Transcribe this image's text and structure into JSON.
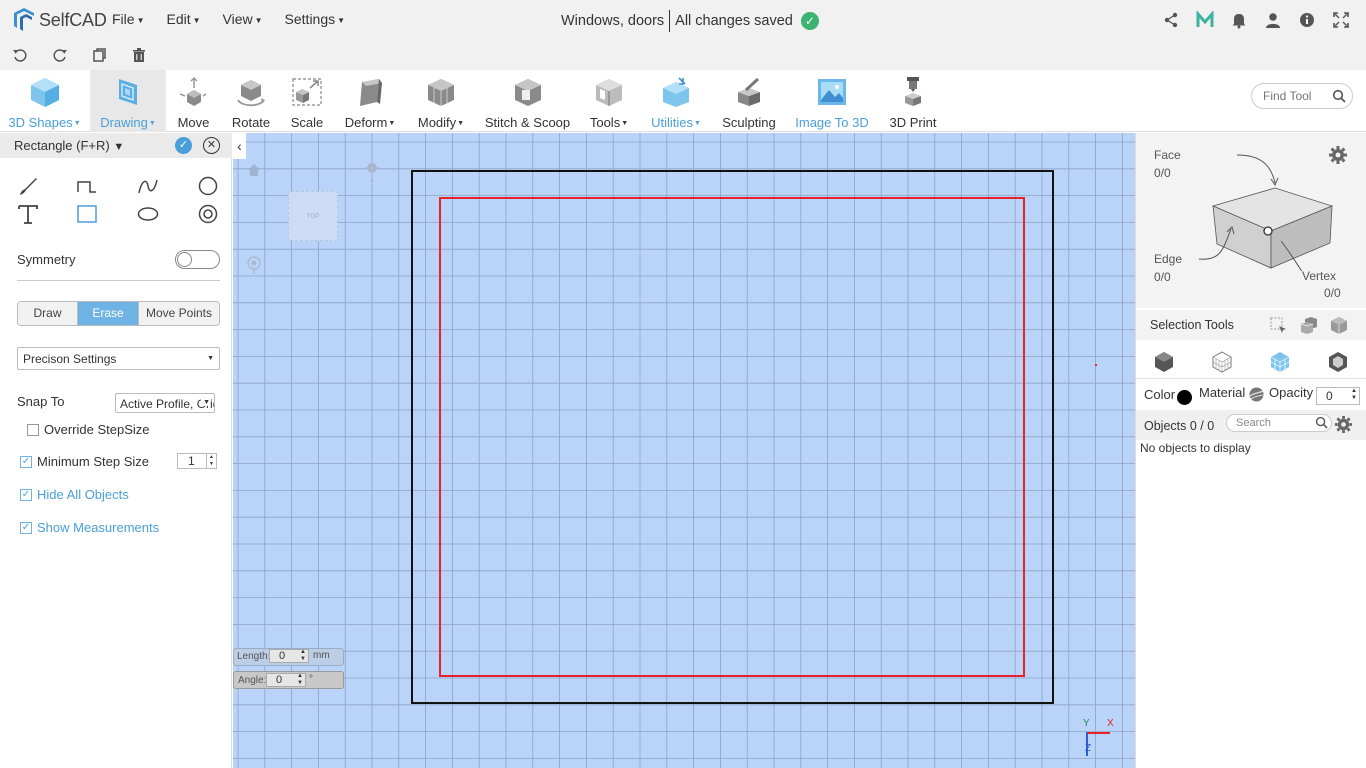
{
  "app": {
    "name": "SelfCAD"
  },
  "menus": [
    "File",
    "Edit",
    "View",
    "Settings"
  ],
  "document": {
    "title": "Windows, doors",
    "save_status": "All changes saved"
  },
  "toolbar": {
    "tools": [
      {
        "label": "3D Shapes",
        "has_menu": true
      },
      {
        "label": "Drawing",
        "has_menu": true
      },
      {
        "label": "Move",
        "has_menu": false
      },
      {
        "label": "Rotate",
        "has_menu": false
      },
      {
        "label": "Scale",
        "has_menu": false
      },
      {
        "label": "Deform",
        "has_menu": true
      },
      {
        "label": "Modify",
        "has_menu": true
      },
      {
        "label": "Stitch & Scoop",
        "has_menu": false
      },
      {
        "label": "Tools",
        "has_menu": true
      },
      {
        "label": "Utilities",
        "has_menu": true
      },
      {
        "label": "Sculpting",
        "has_menu": false
      },
      {
        "label": "Image To 3D",
        "has_menu": false
      },
      {
        "label": "3D Print",
        "has_menu": false
      }
    ],
    "find_placeholder": "Find Tool"
  },
  "left_panel": {
    "title": "Rectangle (F+R)",
    "symmetry_label": "Symmetry",
    "symmetry_on": false,
    "mode_buttons": [
      "Draw",
      "Erase",
      "Move Points"
    ],
    "active_mode": "Erase",
    "precision_label": "Precison Settings",
    "snap_label": "Snap To",
    "snap_value": "Active Profile, Grid",
    "override_label": "Override StepSize",
    "min_step_label": "Minimum Step Size",
    "min_step_value": "1",
    "hide_objects_label": "Hide All Objects",
    "show_measurements_label": "Show Measurements"
  },
  "canvas": {
    "view_cube_label": "TOP",
    "length_label": "Length:",
    "length_value": "0",
    "length_unit": "mm",
    "angle_label": "Angle:",
    "angle_value": "0",
    "angle_unit": "°",
    "axis_y": "Y",
    "axis_x": "X",
    "axis_z": "Z"
  },
  "right_panel": {
    "face_label": "Face",
    "face_count": "0/0",
    "edge_label": "Edge",
    "edge_count": "0/0",
    "vertex_label": "Vertex",
    "vertex_count": "0/0",
    "selection_tools_label": "Selection Tools",
    "color_label": "Color",
    "material_label": "Material",
    "opacity_label": "Opacity",
    "opacity_value": "0",
    "objects_label": "Objects 0 / 0",
    "search_placeholder": "Search",
    "empty_text": "No objects to display"
  },
  "colors": {
    "accent": "#4a9fd8",
    "canvas_bg": "#b9d3f9",
    "saved_check": "#3cb371",
    "outer_rect": "#111111",
    "inner_rect": "#e8212b"
  }
}
